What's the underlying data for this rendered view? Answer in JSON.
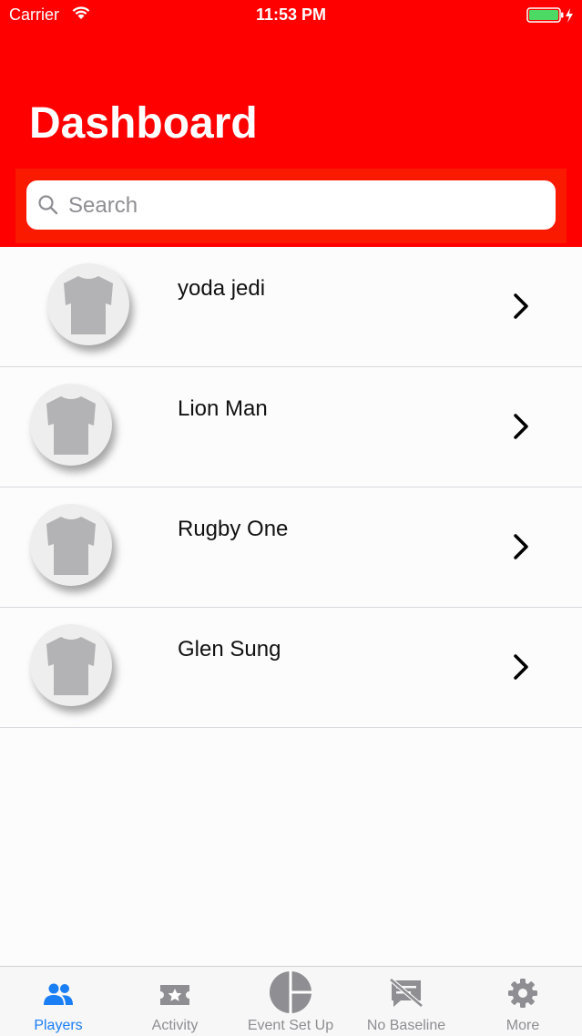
{
  "status_bar": {
    "carrier": "Carrier",
    "time": "11:53 PM"
  },
  "header": {
    "title": "Dashboard"
  },
  "search": {
    "placeholder": "Search"
  },
  "players": [
    {
      "name": "yoda jedi"
    },
    {
      "name": "Lion Man"
    },
    {
      "name": "Rugby One"
    },
    {
      "name": "Glen Sung"
    }
  ],
  "tabs": [
    {
      "label": "Players",
      "icon": "people-icon",
      "active": true
    },
    {
      "label": "Activity",
      "icon": "ticket-star-icon",
      "active": false
    },
    {
      "label": "Event Set Up",
      "icon": "pie-chart-icon",
      "active": false
    },
    {
      "label": "No Baseline",
      "icon": "no-baseline-icon",
      "active": false
    },
    {
      "label": "More",
      "icon": "gear-icon",
      "active": false
    }
  ],
  "colors": {
    "header": "#ff0000",
    "active_tab": "#1a7ef5",
    "inactive_tab": "#8e8e93"
  }
}
